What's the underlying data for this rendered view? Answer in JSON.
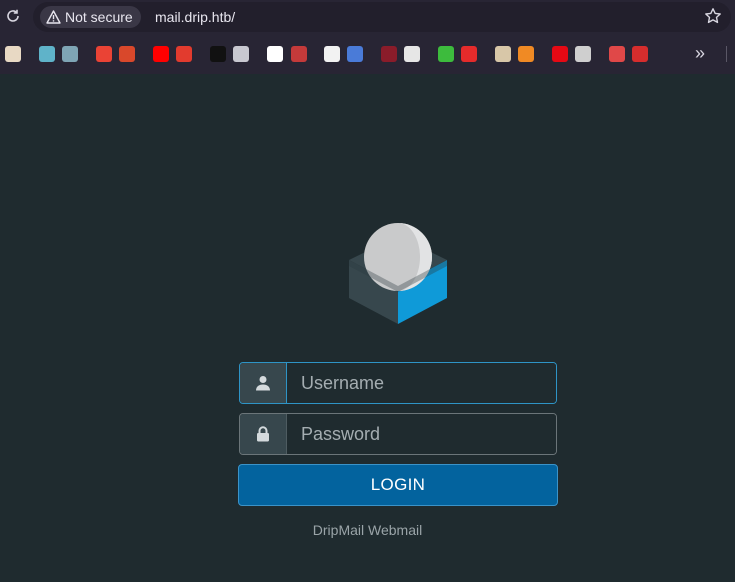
{
  "browser": {
    "security_label": "Not secure",
    "url": "mail.drip.htb/",
    "bookmarks": [
      {
        "icon": "astronaut-icon",
        "color": "#e8d9c4"
      },
      {
        "icon": "globe-icon",
        "color": "#5fb3c9"
      },
      {
        "icon": "ufo-icon",
        "color": "#7fa5b5"
      },
      {
        "icon": "gmail-icon",
        "color": "#ea4335"
      },
      {
        "icon": "fire-mask-icon",
        "color": "#d9482b"
      },
      {
        "icon": "youtube-icon",
        "color": "#ff0000"
      },
      {
        "icon": "torii-gate-icon",
        "color": "#e23b2e"
      },
      {
        "icon": "dark-square-icon",
        "color": "#111111"
      },
      {
        "icon": "wolf-icon",
        "color": "#c8c8d0"
      },
      {
        "icon": "r-letter-icon",
        "color": "#ffffff"
      },
      {
        "icon": "vampire-icon",
        "color": "#c43a3a"
      },
      {
        "icon": "vo-badge-icon",
        "color": "#f2f2f2"
      },
      {
        "icon": "flag-blue-icon",
        "color": "#4a7bd8"
      },
      {
        "icon": "red-circle-icon",
        "color": "#8a1c2a"
      },
      {
        "icon": "checkered-flag-icon",
        "color": "#e6e6e6"
      },
      {
        "icon": "green-cube-icon",
        "color": "#3dbb3d"
      },
      {
        "icon": "red-flag-icon",
        "color": "#e52b2b"
      },
      {
        "icon": "cowboy-icon",
        "color": "#d8c7a8"
      },
      {
        "icon": "fox-icon",
        "color": "#f08a24"
      },
      {
        "icon": "netflix-icon",
        "color": "#e50914"
      },
      {
        "icon": "clapper-icon",
        "color": "#cfcfcf"
      },
      {
        "icon": "santa-icon",
        "color": "#e04848"
      },
      {
        "icon": "red-box-icon",
        "color": "#d62d2d"
      }
    ]
  },
  "login": {
    "username_placeholder": "Username",
    "password_placeholder": "Password",
    "button_label": "LOGIN",
    "footer": "DripMail Webmail"
  },
  "colors": {
    "background": "#1f2b2f",
    "button": "#03639e",
    "accent": "#2e94c6"
  }
}
